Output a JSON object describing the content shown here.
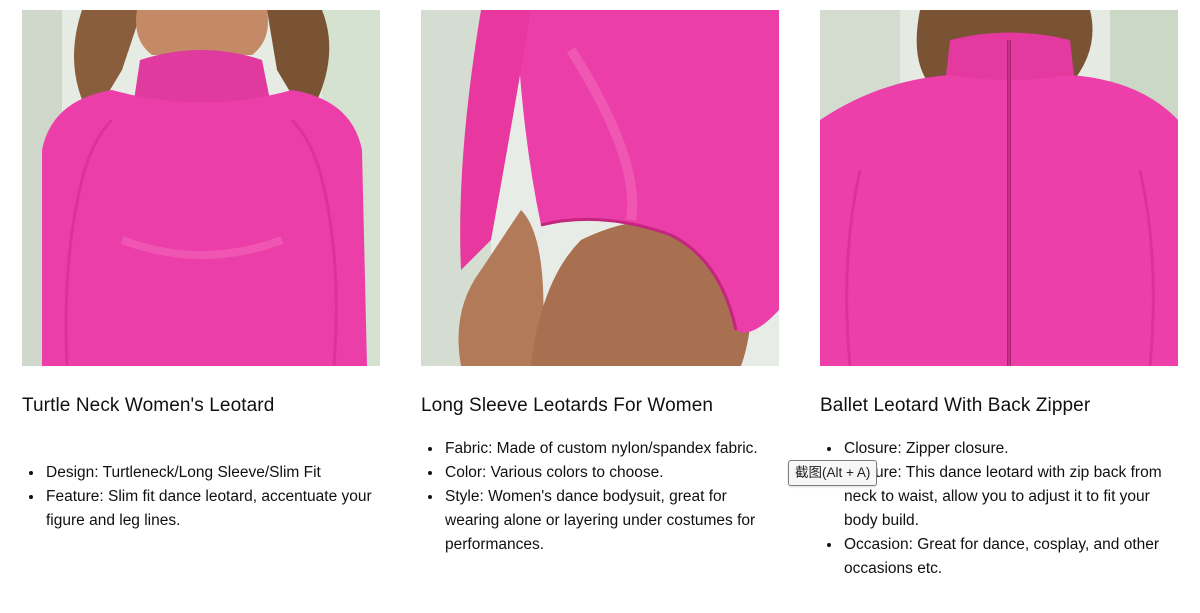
{
  "products": [
    {
      "image_alt": "photo-turtleneck",
      "title": "Turtle Neck Women's Leotard",
      "bullets": [
        "Design: Turtleneck/Long Sleeve/Slim Fit",
        "Feature: Slim fit dance leotard, accentuate your figure and leg lines."
      ]
    },
    {
      "image_alt": "photo-long-sleeve",
      "title": "Long Sleeve Leotards For Women",
      "bullets": [
        "Fabric: Made of custom nylon/spandex fabric.",
        "Color: Various colors to choose.",
        "Style: Women's dance bodysuit, great for wearing alone or layering under costumes for performances."
      ]
    },
    {
      "image_alt": "photo-back-zipper",
      "title": "Ballet Leotard With Back Zipper",
      "bullets": [
        "Closure: Zipper closure.",
        "Feature: This dance leotard with zip back from neck to waist, allow you to adjust it to fit your body build.",
        "Occasion: Great for dance, cosplay, and other occasions etc."
      ]
    }
  ],
  "tooltip": {
    "text": "截图(Alt + A)"
  },
  "colors": {
    "leotard": "#e93aa6",
    "skin": "#b97e5e",
    "hair": "#7a5234",
    "bg_window": "#dfe7dc"
  }
}
